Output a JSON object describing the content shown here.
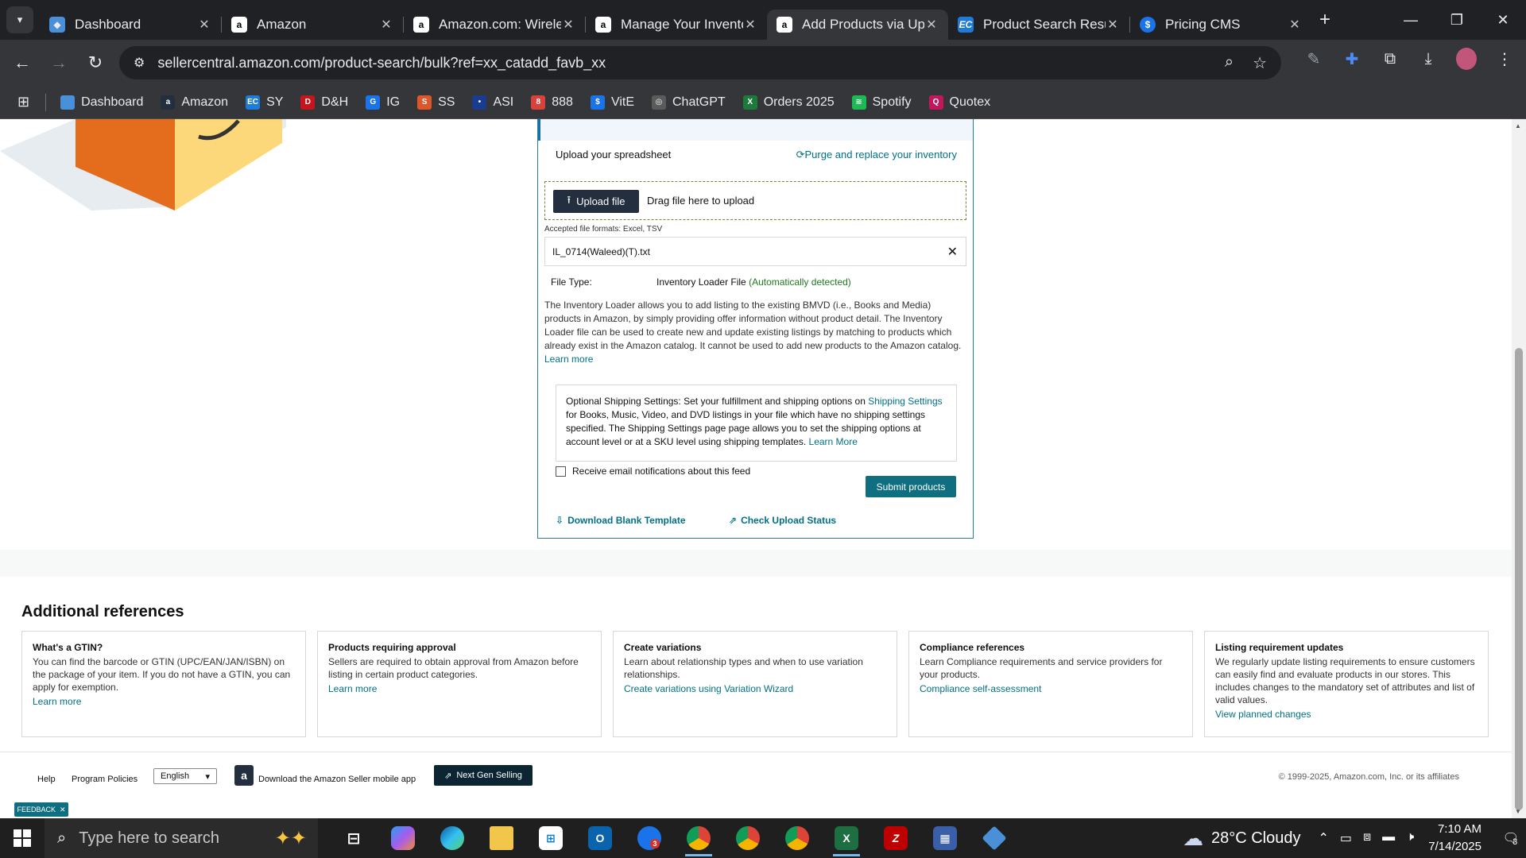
{
  "browser": {
    "tabs": [
      {
        "title": "Dashboard",
        "favicon": "#4a90d9",
        "active": false
      },
      {
        "title": "Amazon",
        "favicon": "#ffffff",
        "active": false
      },
      {
        "title": "Amazon.com: Wirele",
        "favicon": "#ffffff",
        "active": false
      },
      {
        "title": "Manage Your Invento",
        "favicon": "#ffffff",
        "active": false
      },
      {
        "title": "Add Products via Upl",
        "favicon": "#ffffff",
        "active": true
      },
      {
        "title": "Product Search Resul",
        "favicon": "#1f7bd8",
        "active": false
      },
      {
        "title": "Pricing CMS",
        "favicon": "#1a73e8",
        "active": false
      }
    ],
    "url": "sellercentral.amazon.com/product-search/bulk?ref=xx_catadd_favb_xx",
    "bookmarks": [
      {
        "label": "Dashboard",
        "color": "#4a90d9",
        "glyph": ""
      },
      {
        "label": "Amazon",
        "color": "#232f3e",
        "glyph": "a"
      },
      {
        "label": "SY",
        "color": "#1f7bd8",
        "glyph": "EC"
      },
      {
        "label": "D&H",
        "color": "#c4161c",
        "glyph": "D"
      },
      {
        "label": "IG",
        "color": "#1a73e8",
        "glyph": "G"
      },
      {
        "label": "SS",
        "color": "#e0562b",
        "glyph": "S"
      },
      {
        "label": "ASI",
        "color": "#1a3c8f",
        "glyph": "•"
      },
      {
        "label": "888",
        "color": "#d9413b",
        "glyph": "8"
      },
      {
        "label": "VitE",
        "color": "#1a73e8",
        "glyph": "$"
      },
      {
        "label": "ChatGPT",
        "color": "#5b5b5b",
        "glyph": "◎"
      },
      {
        "label": "Orders 2025",
        "color": "#1e7a3c",
        "glyph": "X"
      },
      {
        "label": "Spotify",
        "color": "#1db954",
        "glyph": "≋"
      },
      {
        "label": "Quotex",
        "color": "#c2185b",
        "glyph": "Q"
      }
    ]
  },
  "upload": {
    "label": "Upload your spreadsheet",
    "purge": "Purge and replace your inventory",
    "upload_button": "Upload file",
    "drag_text": "Drag file here to upload",
    "accepted": "Accepted file formats: Excel, TSV",
    "file_name": "IL_0714(Waleed)(T).txt",
    "file_type_label": "File Type:",
    "file_type_value": "Inventory Loader File",
    "file_type_auto": "(Automatically detected)",
    "description": "The Inventory Loader allows you to add listing to the existing BMVD (i.e., Books and Media) products in Amazon, by simply providing offer information without product detail. The Inventory Loader file can be used to create new and update existing listings by matching to products which already exist in the Amazon catalog. It cannot be used to add new products to the Amazon catalog.",
    "description_link": "Learn more",
    "shipping_prefix": "Optional Shipping Settings: Set your fulfillment and shipping options on",
    "shipping_link": "Shipping Settings",
    "shipping_suffix": "for Books, Music, Video, and DVD listings in your file which have no shipping settings specified. The Shipping Settings page page allows you to set the shipping options at account level or at a SKU level using shipping templates.",
    "shipping_learn": "Learn More",
    "email_checkbox": "Receive email notifications about this feed",
    "submit": "Submit products",
    "download_template": "Download Blank Template",
    "check_status": "Check Upload Status"
  },
  "references": {
    "title": "Additional references",
    "cards": [
      {
        "heading": "What's a GTIN?",
        "body": "You can find the barcode or GTIN (UPC/EAN/JAN/ISBN) on the package of your item. If you do not have a GTIN, you can apply for exemption.",
        "link": "Learn more"
      },
      {
        "heading": "Products requiring approval",
        "body": "Sellers are required to obtain approval from Amazon before listing in certain product categories.",
        "link": "Learn more"
      },
      {
        "heading": "Create variations",
        "body": "Learn about relationship types and when to use variation relationships.",
        "link": "Create variations using Variation Wizard"
      },
      {
        "heading": "Compliance references",
        "body": "Learn Compliance requirements and service providers for your products.",
        "link": "Compliance self-assessment"
      },
      {
        "heading": "Listing requirement updates",
        "body": "We regularly update listing requirements to ensure customers can easily find and evaluate products in our stores. This includes changes to the mandatory set of attributes and list of valid values.",
        "link": "View planned changes"
      }
    ]
  },
  "footer": {
    "help": "Help",
    "policies": "Program Policies",
    "language": "English",
    "app_text": "Download the Amazon Seller mobile app",
    "next_gen": "Next Gen Selling",
    "copyright": "© 1999-2025, Amazon.com, Inc. or its affiliates",
    "feedback": "FEEDBACK"
  },
  "taskbar": {
    "search_placeholder": "Type here to search",
    "weather": "28°C  Cloudy",
    "time": "7:10 AM",
    "date": "7/14/2025",
    "notifications": "3",
    "mail_badge": "3"
  }
}
